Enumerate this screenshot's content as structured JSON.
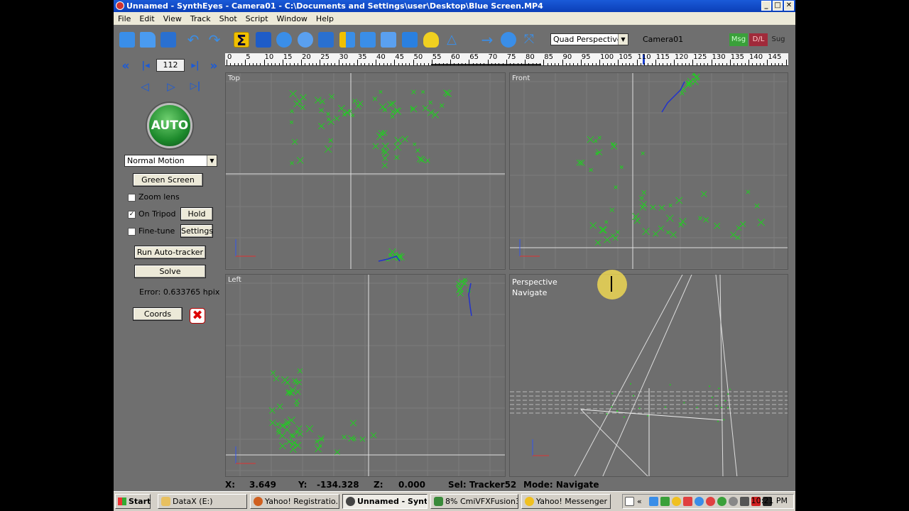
{
  "window": {
    "title": "Unnamed - SynthEyes - Camera01 - C:\\Documents and Settings\\user\\Desktop\\Blue Screen.MP4",
    "minimize": "_",
    "maximize": "□",
    "close": "✕"
  },
  "menu": [
    "File",
    "Edit",
    "View",
    "Track",
    "Shot",
    "Script",
    "Window",
    "Help"
  ],
  "toolbar": {
    "icons": [
      "new-file-icon",
      "open-folder-icon",
      "save-icon",
      "undo-icon",
      "redo-icon",
      "solver-sigma-icon",
      "camera-icon",
      "settings-gear-icon",
      "tracker-cluster-icon",
      "coordinate-icon",
      "lens-icon",
      "graph-icon",
      "curve-editor-icon",
      "cube-icon",
      "light-bulb-icon",
      "path-icon",
      "arrow-right-icon",
      "clock-icon",
      "expand-icon"
    ],
    "sigma_label": "Σ",
    "view_layout": "Quad Perspective",
    "camera": "Camera01",
    "msg": "Msg",
    "dl": "D/L",
    "sug": "Sug"
  },
  "timeline": {
    "labels": [
      "0",
      "5",
      "10",
      "15",
      "20",
      "25",
      "30",
      "35",
      "40",
      "45",
      "50",
      "55",
      "60",
      "65",
      "70",
      "75",
      "80",
      "85",
      "90",
      "95",
      "100",
      "105",
      "110",
      "115",
      "120",
      "125",
      "130",
      "135",
      "140",
      "145"
    ],
    "current_frame": 112
  },
  "leftpanel": {
    "frame": "112",
    "nav": {
      "rewind": "«",
      "prev_key": "|◂",
      "next_key": "▸|",
      "forward": "»",
      "step_back": "◁",
      "play": "▷",
      "step_fwd": "▷|"
    },
    "auto": "AUTO",
    "motion": "Normal Motion",
    "green_screen": "Green Screen",
    "zoom_lens": "Zoom lens",
    "zoom_lens_checked": false,
    "on_tripod": "On Tripod",
    "on_tripod_checked": true,
    "hold": "Hold",
    "fine_tune": "Fine-tune",
    "fine_tune_checked": false,
    "settings": "Settings",
    "run_autotracker": "Run Auto-tracker",
    "solve": "Solve",
    "error": "Error: 0.633765 hpix",
    "coords": "Coords",
    "x_mark": "✖"
  },
  "viewports": {
    "top": "Top",
    "front": "Front",
    "left": "Left",
    "perspective": "Perspective",
    "navigate": "Navigate"
  },
  "status": {
    "x_label": "X:",
    "x": "3.649",
    "y_label": "Y:",
    "y": "-134.328",
    "z_label": "Z:",
    "z": "0.000",
    "sel": "Sel: Tracker52",
    "mode": "Mode: Navigate"
  },
  "taskbar": {
    "start": "Start",
    "tasks": [
      {
        "label": "DataX (E:)",
        "color": "#e8c060"
      },
      {
        "label": "Yahoo! Registratio...",
        "color": "#d06020"
      },
      {
        "label": "Unnamed - Synt...",
        "color": "#444444"
      },
      {
        "label": "8% CmiVFXFusion3...",
        "color": "#3a8a3a"
      },
      {
        "label": "Yahoo! Messenger",
        "color": "#f0c020"
      }
    ],
    "clock": "10:21 PM"
  },
  "colors": {
    "tracker": "#22cc22",
    "path": "#2233cc",
    "accent_sigma": "#f0c000"
  }
}
